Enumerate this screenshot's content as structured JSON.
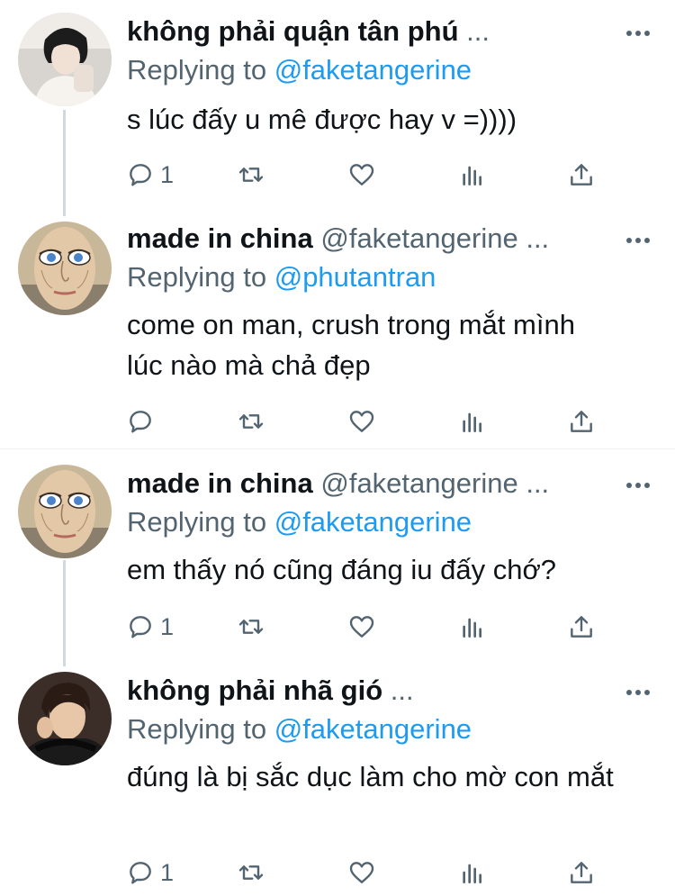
{
  "tweets": [
    {
      "name": "không phải quận tân phú",
      "handle": "",
      "ellipsis": "...",
      "replying_prefix": "Replying to",
      "replying_to": "@faketangerine",
      "text": "s lúc đấy u mê được hay v =))))",
      "reply_count": "1"
    },
    {
      "name": "made in china",
      "handle": "@faketangerine",
      "ellipsis": "...",
      "replying_prefix": "Replying to",
      "replying_to": "@phutantran",
      "text": "come on man, crush trong mắt mình lúc nào mà chả đẹp",
      "reply_count": ""
    },
    {
      "name": "made in china",
      "handle": "@faketangerine",
      "ellipsis": "...",
      "replying_prefix": "Replying to",
      "replying_to": "@faketangerine",
      "text": "em thấy nó cũng đáng iu đấy chớ?",
      "reply_count": "1"
    },
    {
      "name": "không phải nhã gió",
      "handle": "",
      "ellipsis": "...",
      "replying_prefix": "Replying to",
      "replying_to": "@faketangerine",
      "text": "đúng là bị sắc dục làm cho mờ con mắt",
      "reply_count": "1"
    }
  ],
  "icons": {
    "more": "more-dots-icon",
    "reply": "reply-bubble-icon",
    "retweet": "retweet-icon",
    "like": "heart-icon",
    "views": "analytics-bars-icon",
    "share": "share-upload-icon"
  },
  "colors": {
    "link": "#1d9bf0",
    "secondary": "#536471",
    "text": "#0f1419"
  }
}
